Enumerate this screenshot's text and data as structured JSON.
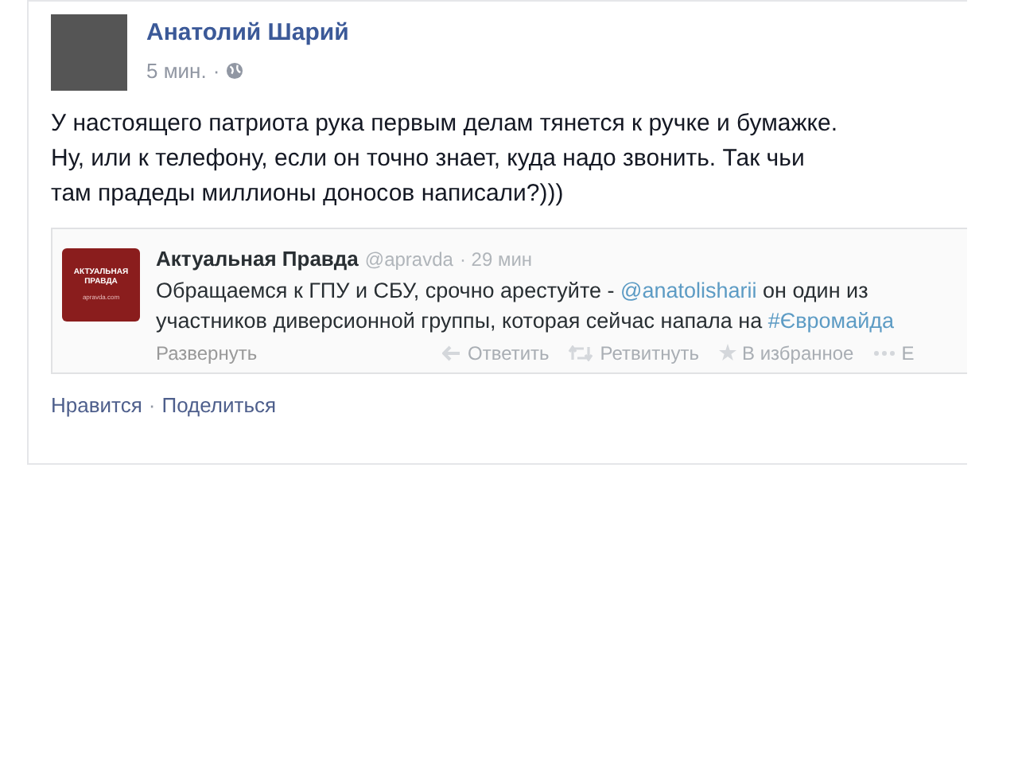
{
  "post": {
    "author": "Анатолий Шарий",
    "time": "5 мин.",
    "separator": "·",
    "text_lines": [
      "У настоящего патриота рука первым делам тянется к ручке и бумажке.",
      "Ну, или к телефону, если он точно знает, куда надо звонить. Так чьи",
      "там прадеды миллионы доносов написали?)))"
    ]
  },
  "tweet": {
    "logo_lines": [
      "АКТУАЛЬНАЯ",
      "ПРАВДА"
    ],
    "logo_site": "apravda.com",
    "name": "Актуальная Правда",
    "handle": "@apravda",
    "time": "· 29 мин",
    "text_before": "Обращаемся к ГПУ и СБУ, срочно арестуйте -",
    "mention": "@anatolisharii",
    "text_middle": "он один из",
    "text_line2": "участников диверсионной группы, которая сейчас напала на",
    "hashtag": "#Євромайда",
    "expand": "Развернуть",
    "actions": [
      {
        "kind": "reply",
        "label": "Ответить"
      },
      {
        "kind": "retweet",
        "label": "Ретвитнуть"
      },
      {
        "kind": "favorite",
        "label": "В избранное"
      },
      {
        "kind": "more",
        "label": "Е"
      }
    ]
  },
  "footer": [
    {
      "label": "Нравится"
    },
    {
      "label": "Поделиться"
    }
  ],
  "footer_separator": "·"
}
